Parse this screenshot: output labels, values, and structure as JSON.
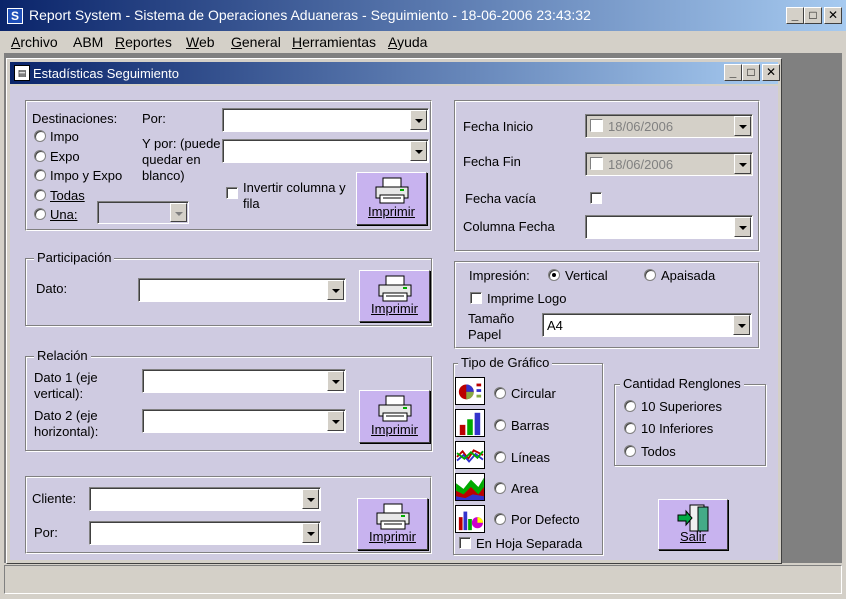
{
  "window": {
    "title": "Report System - Sistema de Operaciones Aduaneras - Seguimiento - 18-06-2006 23:43:32",
    "app_icon": "S"
  },
  "menu": [
    {
      "label": "Archivo",
      "underline": "A",
      "rest": "rchivo"
    },
    {
      "label": "ABM",
      "underline": "",
      "rest": "ABM"
    },
    {
      "label": "Reportes",
      "underline": "R",
      "rest": "eportes"
    },
    {
      "label": "Web",
      "underline": "W",
      "rest": "eb"
    },
    {
      "label": "General",
      "underline": "G",
      "rest": "eneral"
    },
    {
      "label": "Herramientas",
      "underline": "H",
      "rest": "erramientas"
    },
    {
      "label": "Ayuda",
      "underline": "A",
      "rest": "yuda"
    }
  ],
  "child": {
    "title": "Estadísticas Seguimiento"
  },
  "seguimiento": {
    "destinaciones_label": "Destinaciones:",
    "options": [
      "Impo",
      "Expo",
      "Impo y Expo",
      "Todas",
      "Una:"
    ],
    "por_label": "Por:",
    "ypor_label_1": "Y por: (puede",
    "ypor_label_2": "quedar en",
    "ypor_label_3": "blanco)",
    "invertir_1": "Invertir columna y",
    "invertir_2": "fila",
    "imprimir": "Imprimir"
  },
  "participacion": {
    "legend": "Participación",
    "dato_label": "Dato:",
    "imprimir": "Imprimir"
  },
  "relacion": {
    "legend": "Relación",
    "dato1_1": "Dato 1 (eje",
    "dato1_2": "vertical):",
    "dato2_1": "Dato 2 (eje",
    "dato2_2": "horizontal):",
    "imprimir": "Imprimir"
  },
  "cliente": {
    "cliente_label": "Cliente:",
    "por_label": "Por:",
    "imprimir": "Imprimir"
  },
  "fechas": {
    "inicio_label": "Fecha Inicio",
    "inicio_value": "18/06/2006",
    "fin_label": "Fecha Fin",
    "fin_value": "18/06/2006",
    "vacia_label": "Fecha vacía",
    "columna_label": "Columna Fecha"
  },
  "impresion": {
    "label": "Impresión:",
    "vertical": "Vertical",
    "apaisada": "Apaisada",
    "logo": "Imprime Logo",
    "tamano_1": "Tamaño",
    "tamano_2": "Papel",
    "tamano_value": "A4"
  },
  "grafico": {
    "legend": "Tipo de Gráfico",
    "options": [
      "Circular",
      "Barras",
      "Líneas",
      "Area",
      "Por Defecto"
    ],
    "separada": "En Hoja Separada",
    "icons": [
      "pie-chart-icon",
      "bar-chart-icon",
      "line-chart-icon",
      "area-chart-icon",
      "default-chart-icon"
    ]
  },
  "renglones": {
    "legend": "Cantidad Renglones",
    "options": [
      "10 Superiores",
      "10 Inferiores",
      "Todos"
    ]
  },
  "salir": "Salir"
}
